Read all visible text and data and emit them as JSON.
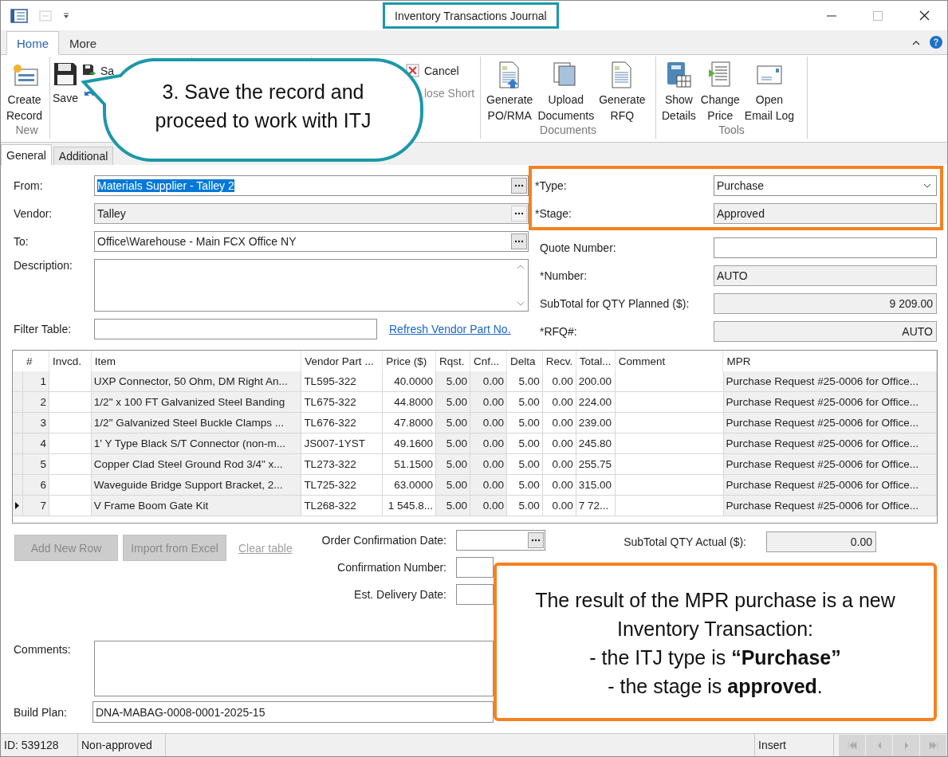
{
  "window": {
    "title": "Inventory Transactions Journal",
    "title_highlighted": true
  },
  "ribbon": {
    "tabs": [
      {
        "label": "Home",
        "selected": true
      },
      {
        "label": "More",
        "selected": false
      }
    ],
    "groups": [
      {
        "kind": "buttons",
        "label": "New",
        "large": [
          {
            "label": "Create\nRecord"
          }
        ]
      },
      {
        "kind": "buttons",
        "large": [
          {
            "label": "Save"
          }
        ],
        "small": [
          {
            "label": "Sa",
            "disabled": false
          },
          {
            "disabled": false
          }
        ]
      },
      {
        "kind": "covered"
      },
      {
        "kind": "buttons",
        "small": [
          {
            "label": "Cancel",
            "disabled": false
          },
          {
            "label": "lose Short",
            "disabled": true
          }
        ]
      },
      {
        "kind": "buttons",
        "label": "Documents",
        "large": [
          {
            "label": "Generate\nPO/RMA"
          },
          {
            "label": "Upload\nDocuments"
          },
          {
            "label": "Generate\nRFQ"
          }
        ]
      },
      {
        "kind": "buttons",
        "label": "Tools",
        "large": [
          {
            "label": "Show\nDetails"
          },
          {
            "label": "Change\nPrice"
          },
          {
            "label": "Open\nEmail Log"
          }
        ]
      }
    ]
  },
  "form_tabs": [
    {
      "label": "General",
      "selected": true
    },
    {
      "label": "Additional",
      "selected": false
    }
  ],
  "left_fields": [
    {
      "kind": "picker",
      "label": "From:",
      "value": "Materials Supplier - Talley 2",
      "readonly": false,
      "selected": true
    },
    {
      "kind": "picker",
      "label": "Vendor:",
      "value": "Talley",
      "readonly": true,
      "selected": false
    },
    {
      "kind": "picker",
      "label": "To:",
      "value": "Office\\Warehouse - Main FCX Office NY",
      "readonly": false,
      "selected": false
    },
    {
      "kind": "textarea",
      "label": "Description:",
      "readonly": false
    },
    {
      "kind": "filter",
      "label": "Filter Table:",
      "link": "Refresh Vendor Part No.",
      "readonly": false
    }
  ],
  "highlighted_fields": [
    {
      "kind": "dropdown",
      "label": "*Type:",
      "value": "Purchase",
      "readonly": false
    },
    {
      "kind": "text",
      "label": "*Stage:",
      "value": "Approved",
      "readonly": true
    }
  ],
  "right_fields": [
    {
      "kind": "text",
      "label": "Quote Number:",
      "readonly": false
    },
    {
      "kind": "text",
      "label": "*Number:",
      "value": "AUTO",
      "readonly": true
    },
    {
      "kind": "number",
      "label": "SubTotal for QTY Planned ($):",
      "value": "9 209.00",
      "readonly": true
    },
    {
      "kind": "number",
      "label": "*RFQ#:",
      "value": "AUTO",
      "readonly": true
    }
  ],
  "table": {
    "columns": [
      "#",
      "Invcd.",
      "Item",
      "Vendor Part ...",
      "Price ($)",
      "Rqst.",
      "Cnf...",
      "Delta",
      "Recv.",
      "Total...",
      "Comment",
      "MPR"
    ],
    "rows": [
      {
        "current": false,
        "cells": [
          "1",
          "",
          "UXP Connector, 50 Ohm, DM Right An...",
          "TL595-322",
          "40.0000",
          "5.00",
          "0.00",
          "5.00",
          "0.00",
          "200.00",
          "",
          "Purchase Request #25-0006 for Office..."
        ]
      },
      {
        "current": false,
        "cells": [
          "2",
          "",
          "1/2\" x 100 FT Galvanized Steel Banding",
          "TL675-322",
          "44.8000",
          "5.00",
          "0.00",
          "5.00",
          "0.00",
          "224.00",
          "",
          "Purchase Request #25-0006 for Office..."
        ]
      },
      {
        "current": false,
        "cells": [
          "3",
          "",
          "1/2\" Galvanized Steel Buckle Clamps ...",
          "TL676-322",
          "47.8000",
          "5.00",
          "0.00",
          "5.00",
          "0.00",
          "239.00",
          "",
          "Purchase Request #25-0006 for Office..."
        ]
      },
      {
        "current": false,
        "cells": [
          "4",
          "",
          "1' Y Type Black S/T Connector (non-m...",
          "JS007-1YST",
          "49.1600",
          "5.00",
          "0.00",
          "5.00",
          "0.00",
          "245.80",
          "",
          "Purchase Request #25-0006 for Office..."
        ]
      },
      {
        "current": false,
        "cells": [
          "5",
          "",
          "Copper Clad Steel Ground Rod 3/4\" x...",
          "TL273-322",
          "51.1500",
          "5.00",
          "0.00",
          "5.00",
          "0.00",
          "255.75",
          "",
          "Purchase Request #25-0006 for Office..."
        ]
      },
      {
        "current": false,
        "cells": [
          "6",
          "",
          "Waveguide Bridge Support Bracket, 2...",
          "TL725-322",
          "63.0000",
          "5.00",
          "0.00",
          "5.00",
          "0.00",
          "315.00",
          "",
          "Purchase Request #25-0006 for Office..."
        ]
      },
      {
        "current": true,
        "cells": [
          "7",
          "",
          "V Frame Boom Gate Kit",
          "TL268-322",
          "1 545.8...",
          "5.00",
          "0.00",
          "5.00",
          "0.00",
          "7 72...",
          "",
          "Purchase Request #25-0006 for Office..."
        ]
      }
    ]
  },
  "bottom": {
    "buttons": [
      {
        "label": "Add New Row",
        "disabled": true
      },
      {
        "label": "Import from Excel",
        "disabled": true
      }
    ],
    "link": {
      "label": "Clear table",
      "disabled": true
    },
    "date_fields": [
      {
        "kind": "picker",
        "label": "Order Confirmation Date:"
      },
      {
        "kind": "text",
        "label": "Confirmation Number:"
      },
      {
        "kind": "text",
        "label": "Est. Delivery Date:"
      }
    ],
    "subtotal_actual": {
      "label": "SubTotal QTY Actual ($):",
      "value": "0.00"
    }
  },
  "comments": {
    "label": "Comments:"
  },
  "build_plan": {
    "label": "Build Plan:",
    "value": "DNA-MABAG-0008-0001-2025-15"
  },
  "status_bar": {
    "id": "ID: 539128",
    "approval": "Non-approved",
    "mode": "Insert",
    "nav_disabled": true
  },
  "callouts": [
    {
      "kind": "bubble",
      "text": "3. Save the record and proceed to work with ITJ"
    },
    {
      "kind": "box",
      "lines": [
        "The result of the MPR purchase is a new Inventory Transaction:",
        "- the ITJ type is **“Purchase”**",
        "- the stage is **approved**."
      ]
    }
  ]
}
